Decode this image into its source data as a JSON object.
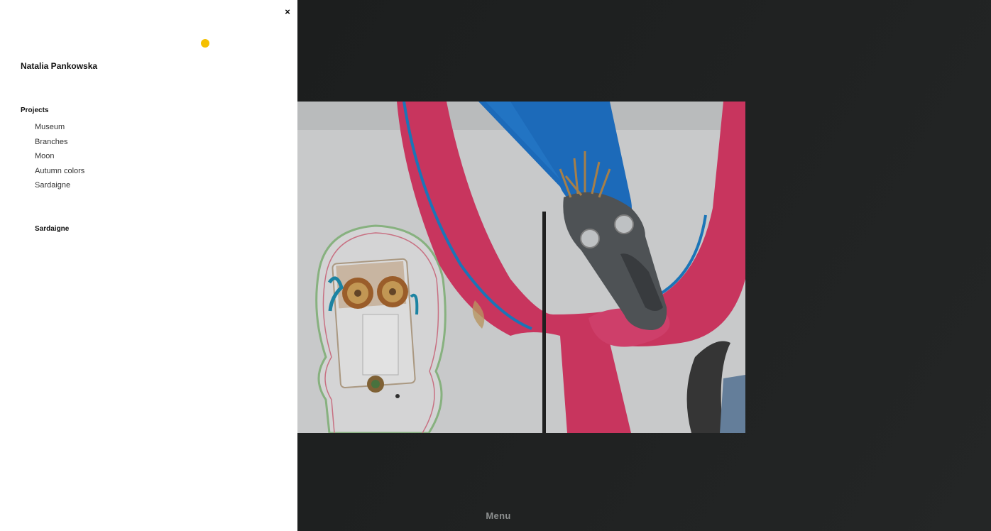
{
  "site": {
    "title": "Natalia Pankowska",
    "accent_color": "#f5c000"
  },
  "menu_panel": {
    "close_icon": "×",
    "section_heading": "Projects",
    "projects": [
      {
        "label": "Museum"
      },
      {
        "label": "Branches"
      },
      {
        "label": "Moon"
      },
      {
        "label": "Autumn colors"
      },
      {
        "label": "Sardaigne"
      }
    ],
    "current_project": "Sardaigne"
  },
  "viewer": {
    "menu_label": "Menu",
    "background_color": "#1d1f1f"
  }
}
